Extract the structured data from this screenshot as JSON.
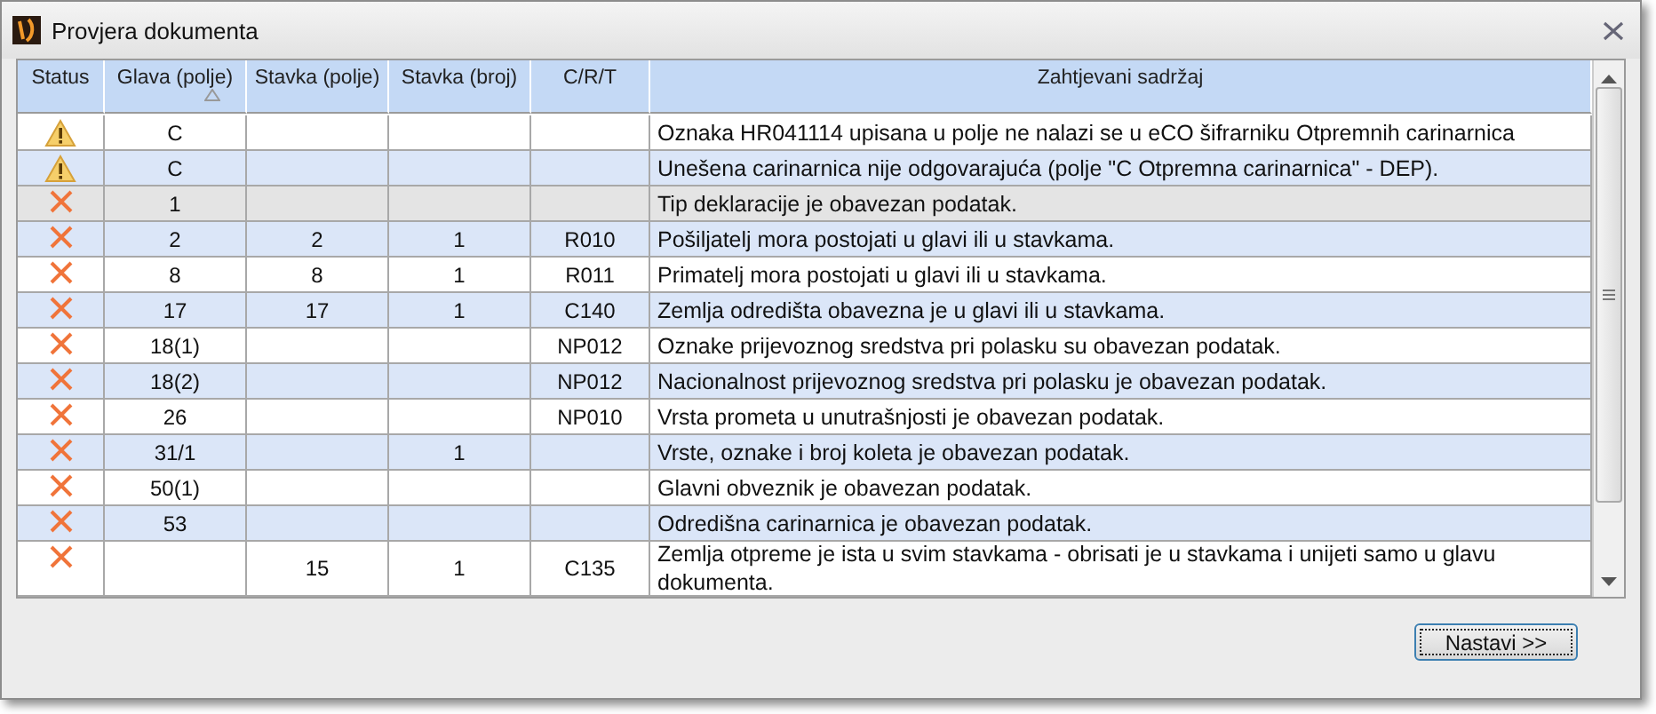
{
  "window": {
    "title": "Provjera dokumenta"
  },
  "table": {
    "columns": [
      {
        "label": "Status",
        "sorted": false
      },
      {
        "label": "Glava (polje)",
        "sorted": true
      },
      {
        "label": "Stavka (polje)",
        "sorted": false
      },
      {
        "label": "Stavka (broj)",
        "sorted": false
      },
      {
        "label": "C/R/T",
        "sorted": false
      },
      {
        "label": "Zahtjevani sadržaj",
        "sorted": false
      }
    ],
    "rows": [
      {
        "kind": "warning",
        "selected": false,
        "glava": "C",
        "stavka_polje": "",
        "stavka_broj": "",
        "crt": "",
        "content": "Oznaka HR041114 upisana u polje ne nalazi se u eCO šifrarniku Otpremnih carinarnica"
      },
      {
        "kind": "warning",
        "selected": false,
        "glava": "C",
        "stavka_polje": "",
        "stavka_broj": "",
        "crt": "",
        "content": "Unešena carinarnica nije odgovarajuća (polje \"C Otpremna carinarnica\" - DEP)."
      },
      {
        "kind": "error",
        "selected": true,
        "glava": "1",
        "stavka_polje": "",
        "stavka_broj": "",
        "crt": "",
        "content": "Tip deklaracije je obavezan podatak."
      },
      {
        "kind": "error",
        "selected": false,
        "glava": "2",
        "stavka_polje": "2",
        "stavka_broj": "1",
        "crt": "R010",
        "content": "Pošiljatelj mora postojati u glavi ili u stavkama."
      },
      {
        "kind": "error",
        "selected": false,
        "glava": "8",
        "stavka_polje": "8",
        "stavka_broj": "1",
        "crt": "R011",
        "content": "Primatelj mora postojati u glavi ili u stavkama."
      },
      {
        "kind": "error",
        "selected": false,
        "glava": "17",
        "stavka_polje": "17",
        "stavka_broj": "1",
        "crt": "C140",
        "content": "Zemlja odredišta obavezna je u glavi ili u stavkama."
      },
      {
        "kind": "error",
        "selected": false,
        "glava": "18(1)",
        "stavka_polje": "",
        "stavka_broj": "",
        "crt": "NP012",
        "content": "Oznake prijevoznog sredstva pri polasku su obavezan podatak."
      },
      {
        "kind": "error",
        "selected": false,
        "glava": "18(2)",
        "stavka_polje": "",
        "stavka_broj": "",
        "crt": "NP012",
        "content": "Nacionalnost prijevoznog sredstva pri polasku je obavezan podatak."
      },
      {
        "kind": "error",
        "selected": false,
        "glava": "26",
        "stavka_polje": "",
        "stavka_broj": "",
        "crt": "NP010",
        "content": "Vrsta prometa u unutrašnjosti je obavezan podatak."
      },
      {
        "kind": "error",
        "selected": false,
        "glava": "31/1",
        "stavka_polje": "",
        "stavka_broj": "1",
        "crt": "",
        "content": "Vrste, oznake i broj koleta je obavezan podatak."
      },
      {
        "kind": "error",
        "selected": false,
        "glava": "50(1)",
        "stavka_polje": "",
        "stavka_broj": "",
        "crt": "",
        "content": "Glavni obveznik je obavezan podatak."
      },
      {
        "kind": "error",
        "selected": false,
        "glava": "53",
        "stavka_polje": "",
        "stavka_broj": "",
        "crt": "",
        "content": "Odredišna carinarnica je obavezan podatak."
      },
      {
        "kind": "error",
        "selected": false,
        "glava": "",
        "stavka_polje": "15",
        "stavka_broj": "1",
        "crt": "C135",
        "content": "Zemlja otpreme je ista u svim stavkama - obrisati je u stavkama i unijeti samo u glavu dokumenta."
      }
    ]
  },
  "buttons": [
    {
      "label": "Nastavi >>"
    }
  ]
}
